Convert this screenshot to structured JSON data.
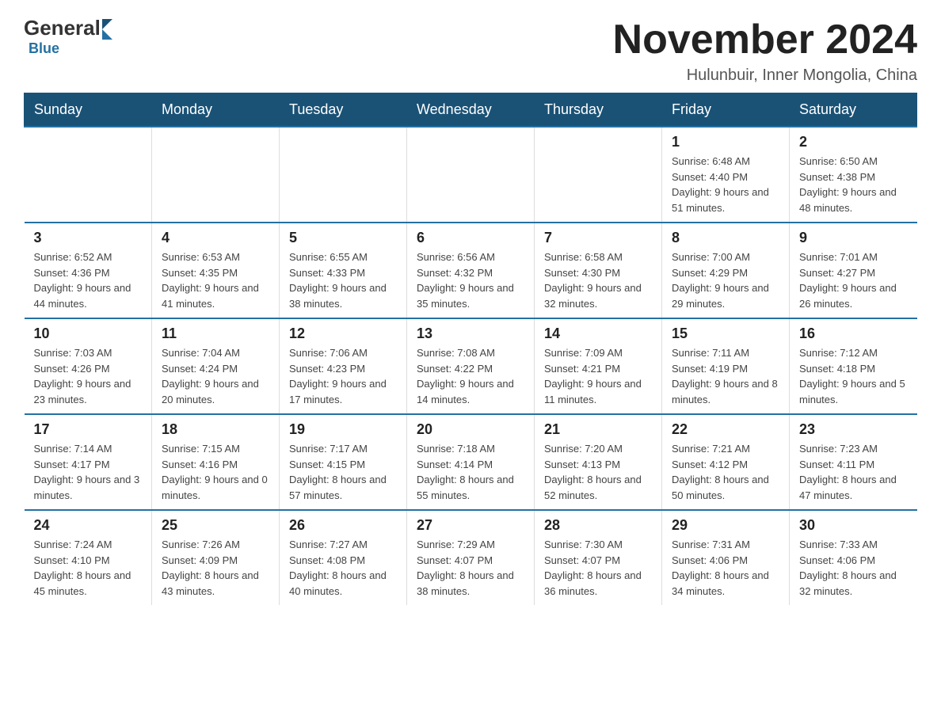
{
  "logo": {
    "general": "General",
    "blue": "Blue"
  },
  "title": "November 2024",
  "location": "Hulunbuir, Inner Mongolia, China",
  "weekdays": [
    "Sunday",
    "Monday",
    "Tuesday",
    "Wednesday",
    "Thursday",
    "Friday",
    "Saturday"
  ],
  "weeks": [
    [
      {
        "day": "",
        "info": ""
      },
      {
        "day": "",
        "info": ""
      },
      {
        "day": "",
        "info": ""
      },
      {
        "day": "",
        "info": ""
      },
      {
        "day": "",
        "info": ""
      },
      {
        "day": "1",
        "info": "Sunrise: 6:48 AM\nSunset: 4:40 PM\nDaylight: 9 hours and 51 minutes."
      },
      {
        "day": "2",
        "info": "Sunrise: 6:50 AM\nSunset: 4:38 PM\nDaylight: 9 hours and 48 minutes."
      }
    ],
    [
      {
        "day": "3",
        "info": "Sunrise: 6:52 AM\nSunset: 4:36 PM\nDaylight: 9 hours and 44 minutes."
      },
      {
        "day": "4",
        "info": "Sunrise: 6:53 AM\nSunset: 4:35 PM\nDaylight: 9 hours and 41 minutes."
      },
      {
        "day": "5",
        "info": "Sunrise: 6:55 AM\nSunset: 4:33 PM\nDaylight: 9 hours and 38 minutes."
      },
      {
        "day": "6",
        "info": "Sunrise: 6:56 AM\nSunset: 4:32 PM\nDaylight: 9 hours and 35 minutes."
      },
      {
        "day": "7",
        "info": "Sunrise: 6:58 AM\nSunset: 4:30 PM\nDaylight: 9 hours and 32 minutes."
      },
      {
        "day": "8",
        "info": "Sunrise: 7:00 AM\nSunset: 4:29 PM\nDaylight: 9 hours and 29 minutes."
      },
      {
        "day": "9",
        "info": "Sunrise: 7:01 AM\nSunset: 4:27 PM\nDaylight: 9 hours and 26 minutes."
      }
    ],
    [
      {
        "day": "10",
        "info": "Sunrise: 7:03 AM\nSunset: 4:26 PM\nDaylight: 9 hours and 23 minutes."
      },
      {
        "day": "11",
        "info": "Sunrise: 7:04 AM\nSunset: 4:24 PM\nDaylight: 9 hours and 20 minutes."
      },
      {
        "day": "12",
        "info": "Sunrise: 7:06 AM\nSunset: 4:23 PM\nDaylight: 9 hours and 17 minutes."
      },
      {
        "day": "13",
        "info": "Sunrise: 7:08 AM\nSunset: 4:22 PM\nDaylight: 9 hours and 14 minutes."
      },
      {
        "day": "14",
        "info": "Sunrise: 7:09 AM\nSunset: 4:21 PM\nDaylight: 9 hours and 11 minutes."
      },
      {
        "day": "15",
        "info": "Sunrise: 7:11 AM\nSunset: 4:19 PM\nDaylight: 9 hours and 8 minutes."
      },
      {
        "day": "16",
        "info": "Sunrise: 7:12 AM\nSunset: 4:18 PM\nDaylight: 9 hours and 5 minutes."
      }
    ],
    [
      {
        "day": "17",
        "info": "Sunrise: 7:14 AM\nSunset: 4:17 PM\nDaylight: 9 hours and 3 minutes."
      },
      {
        "day": "18",
        "info": "Sunrise: 7:15 AM\nSunset: 4:16 PM\nDaylight: 9 hours and 0 minutes."
      },
      {
        "day": "19",
        "info": "Sunrise: 7:17 AM\nSunset: 4:15 PM\nDaylight: 8 hours and 57 minutes."
      },
      {
        "day": "20",
        "info": "Sunrise: 7:18 AM\nSunset: 4:14 PM\nDaylight: 8 hours and 55 minutes."
      },
      {
        "day": "21",
        "info": "Sunrise: 7:20 AM\nSunset: 4:13 PM\nDaylight: 8 hours and 52 minutes."
      },
      {
        "day": "22",
        "info": "Sunrise: 7:21 AM\nSunset: 4:12 PM\nDaylight: 8 hours and 50 minutes."
      },
      {
        "day": "23",
        "info": "Sunrise: 7:23 AM\nSunset: 4:11 PM\nDaylight: 8 hours and 47 minutes."
      }
    ],
    [
      {
        "day": "24",
        "info": "Sunrise: 7:24 AM\nSunset: 4:10 PM\nDaylight: 8 hours and 45 minutes."
      },
      {
        "day": "25",
        "info": "Sunrise: 7:26 AM\nSunset: 4:09 PM\nDaylight: 8 hours and 43 minutes."
      },
      {
        "day": "26",
        "info": "Sunrise: 7:27 AM\nSunset: 4:08 PM\nDaylight: 8 hours and 40 minutes."
      },
      {
        "day": "27",
        "info": "Sunrise: 7:29 AM\nSunset: 4:07 PM\nDaylight: 8 hours and 38 minutes."
      },
      {
        "day": "28",
        "info": "Sunrise: 7:30 AM\nSunset: 4:07 PM\nDaylight: 8 hours and 36 minutes."
      },
      {
        "day": "29",
        "info": "Sunrise: 7:31 AM\nSunset: 4:06 PM\nDaylight: 8 hours and 34 minutes."
      },
      {
        "day": "30",
        "info": "Sunrise: 7:33 AM\nSunset: 4:06 PM\nDaylight: 8 hours and 32 minutes."
      }
    ]
  ]
}
